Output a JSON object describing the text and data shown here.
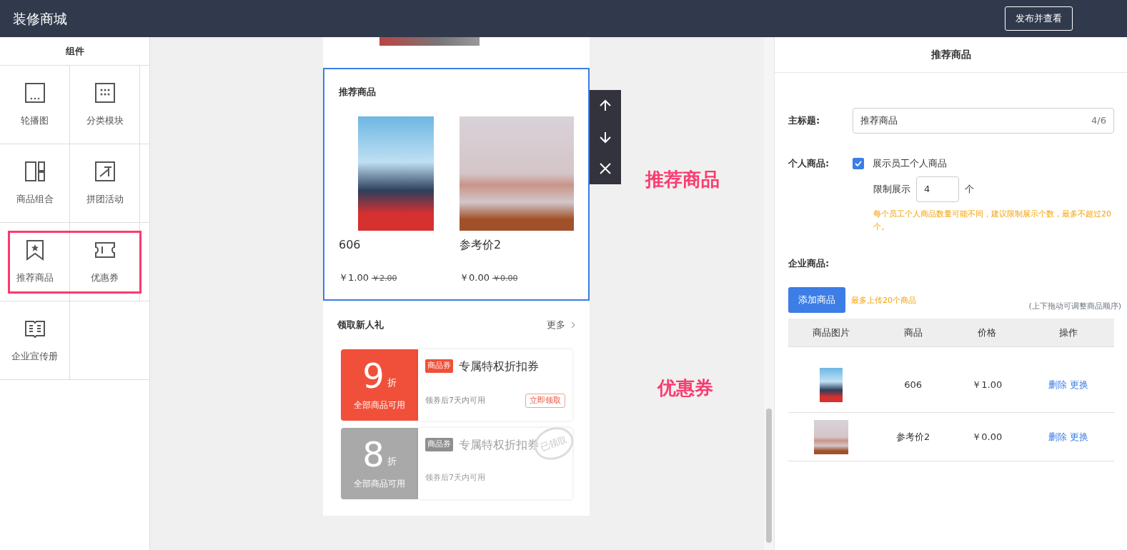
{
  "header": {
    "title": "装修商城",
    "publish_button": "发布并查看"
  },
  "sidebar": {
    "title": "组件",
    "rows": [
      {
        "highlighted": false,
        "items": [
          {
            "label": "轮播图"
          },
          {
            "label": "分类模块"
          }
        ]
      },
      {
        "highlighted": false,
        "items": [
          {
            "label": "商品组合"
          },
          {
            "label": "拼团活动"
          }
        ]
      },
      {
        "highlighted": true,
        "items": [
          {
            "label": "推荐商品"
          },
          {
            "label": "优惠券"
          }
        ]
      },
      {
        "highlighted": false,
        "items": [
          {
            "label": "企业宣传册"
          }
        ]
      }
    ]
  },
  "preview": {
    "recommend": {
      "selected": true,
      "title": "推荐商品",
      "products": [
        {
          "name": "606",
          "price": "￥1.00",
          "original_price": "￥2.00"
        },
        {
          "name": "参考价2",
          "price": "￥0.00",
          "original_price": "￥0.00"
        }
      ]
    },
    "coupons": {
      "title": "领取新人礼",
      "more": "更多",
      "items": [
        {
          "claimed": false,
          "amount": "9",
          "unit": "折",
          "scope": "全部商品可用",
          "tag": "商品券",
          "name": "专属特权折扣券",
          "validity": "领券后7天内可用",
          "action": "立即领取"
        },
        {
          "claimed": true,
          "amount": "8",
          "unit": "折",
          "scope": "全部商品可用",
          "tag": "商品券",
          "name": "专属特权折扣券",
          "validity": "领券后7天内可用",
          "stamp": "已领取"
        }
      ]
    }
  },
  "annotations": [
    "推荐商品",
    "优惠券"
  ],
  "settings": {
    "title": "推荐商品",
    "main_title": {
      "label": "主标题:",
      "value": "推荐商品",
      "counter": "4/6"
    },
    "personal": {
      "label": "个人商品:",
      "checkbox": {
        "label": "展示员工个人商品",
        "checked": true
      },
      "limit_label": "限制展示",
      "limit_value": "4",
      "limit_unit": "个",
      "hint": "每个员工个人商品数量可能不同，建议限制展示个数，最多不超过20个。"
    },
    "enterprise": {
      "label": "企业商品:",
      "add_button": "添加商品",
      "add_hint": "最多上传20个商品",
      "drag_hint": "(上下拖动可调整商品顺序)"
    },
    "table": {
      "columns": [
        "商品图片",
        "商品",
        "价格",
        "操作"
      ],
      "rows": [
        {
          "name": "606",
          "price": "￥1.00",
          "actions": [
            "删除",
            "更换"
          ]
        },
        {
          "name": "参考价2",
          "price": "￥0.00",
          "actions": [
            "删除",
            "更换"
          ]
        }
      ]
    }
  }
}
